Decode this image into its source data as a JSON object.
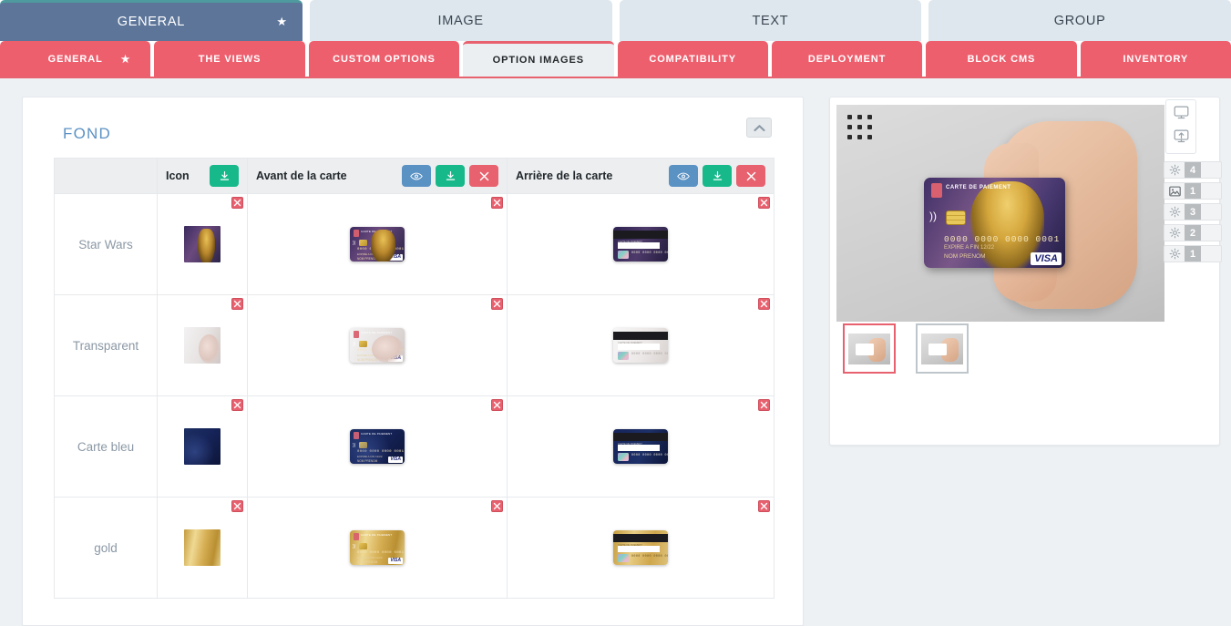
{
  "tabs": {
    "main": [
      {
        "label": "GENERAL",
        "selected": true,
        "star": "★"
      },
      {
        "label": "IMAGE",
        "selected": false,
        "star": ""
      },
      {
        "label": "TEXT",
        "selected": false,
        "star": ""
      },
      {
        "label": "GROUP",
        "selected": false,
        "star": ""
      }
    ],
    "sub": [
      {
        "label": "GENERAL",
        "selected": false,
        "star": "★"
      },
      {
        "label": "THE VIEWS",
        "selected": false,
        "star": ""
      },
      {
        "label": "CUSTOM OPTIONS",
        "selected": false,
        "star": ""
      },
      {
        "label": "OPTION IMAGES",
        "selected": true,
        "star": ""
      },
      {
        "label": "COMPATIBILITY",
        "selected": false,
        "star": ""
      },
      {
        "label": "DEPLOYMENT",
        "selected": false,
        "star": ""
      },
      {
        "label": "BLOCK CMS",
        "selected": false,
        "star": ""
      },
      {
        "label": "INVENTORY",
        "selected": false,
        "star": ""
      }
    ]
  },
  "panel": {
    "title": "FOND",
    "collapse_icon": "chevron-up-icon"
  },
  "table": {
    "columns": [
      {
        "key": "name",
        "label": "",
        "buttons": []
      },
      {
        "key": "icon",
        "label": "Icon",
        "buttons": [
          "download"
        ]
      },
      {
        "key": "front",
        "label": "Avant de la carte",
        "buttons": [
          "eye",
          "download",
          "delete"
        ]
      },
      {
        "key": "back",
        "label": "Arrière de la carte",
        "buttons": [
          "eye",
          "download",
          "delete"
        ]
      }
    ],
    "rows": [
      {
        "name": "Star Wars",
        "art": "sw",
        "back": "b-dark",
        "num": "0000 0000 0000 0001"
      },
      {
        "name": "Transparent",
        "art": "tr",
        "back": "b-white",
        "num": "0000 0000 0000 0001"
      },
      {
        "name": "Carte bleu",
        "art": "bl",
        "back": "b-blue",
        "num": "0000 0000 0000 0001"
      },
      {
        "name": "gold",
        "art": "gd",
        "back": "b-gold",
        "num": "0000 0000 0000 0001"
      }
    ]
  },
  "card_text": {
    "brand": "CARTE DE PAIEMENT",
    "number": "0000 0000 0000 0001",
    "expires": "EXPIRE A FIN 12/22",
    "holder": "NOM PRENOM",
    "network": "VISA",
    "back_top": "CARTE DE PAIEMENT",
    "back_number": "0000 0000 0000 0001"
  },
  "preview": {
    "drag_handle": "drag-dots-icon",
    "view_buttons": [
      {
        "icon": "monitor-icon"
      },
      {
        "icon": "screenshot-icon"
      }
    ],
    "layers": [
      {
        "icon": "gear-icon",
        "count": "4"
      },
      {
        "icon": "image-icon",
        "count": "1"
      },
      {
        "icon": "gear-icon",
        "count": "3"
      },
      {
        "icon": "gear-icon",
        "count": "2"
      },
      {
        "icon": "gear-icon",
        "count": "1"
      }
    ],
    "thumbnails": [
      {
        "label": "view-1",
        "selected": true
      },
      {
        "label": "view-2",
        "selected": false
      }
    ]
  },
  "colors": {
    "accent_red": "#ee5f6e",
    "tab_blue": "#5c7599",
    "tab_light": "#dde7ed",
    "green": "#17b98b",
    "blue": "#5b92c4",
    "title_blue": "#5b92c4"
  }
}
